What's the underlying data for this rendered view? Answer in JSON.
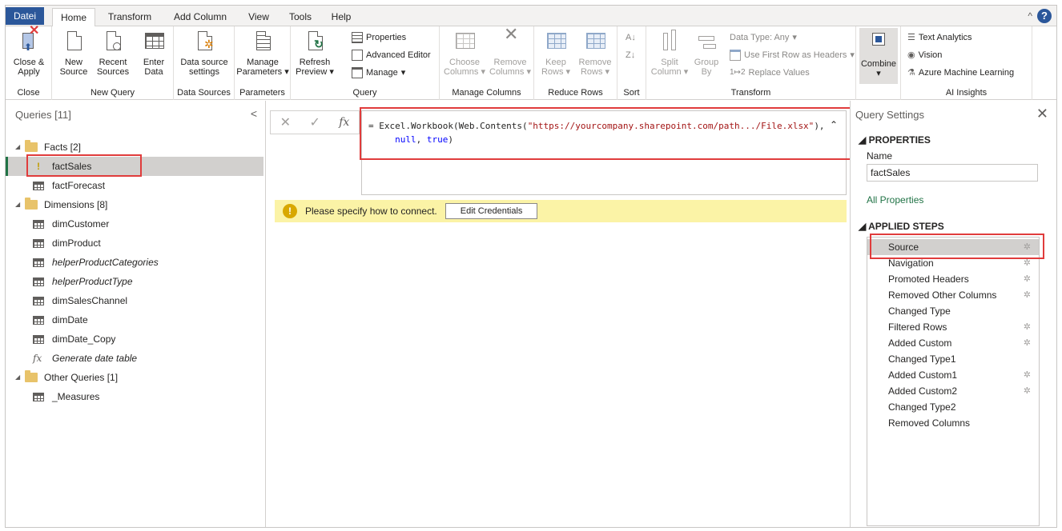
{
  "tabs": [
    "Datei",
    "Home",
    "Transform",
    "Add Column",
    "View",
    "Tools",
    "Help"
  ],
  "ribbon": {
    "close": {
      "close_apply": "Close &",
      "close_apply2": "Apply",
      "group": "Close"
    },
    "new_query": {
      "new": "New",
      "new2": "Source",
      "recent": "Recent",
      "recent2": "Sources",
      "enter": "Enter",
      "enter2": "Data",
      "group": "New Query"
    },
    "data_sources": {
      "settings": "Data source",
      "settings2": "settings",
      "group": "Data Sources"
    },
    "parameters": {
      "manage": "Manage",
      "manage2": "Parameters",
      "group": "Parameters"
    },
    "query": {
      "refresh": "Refresh",
      "refresh2": "Preview",
      "properties": "Properties",
      "advanced": "Advanced Editor",
      "manage": "Manage",
      "group": "Query"
    },
    "manage_columns": {
      "choose": "Choose",
      "choose2": "Columns",
      "remove": "Remove",
      "remove2": "Columns",
      "group": "Manage Columns"
    },
    "reduce_rows": {
      "keep": "Keep",
      "keep2": "Rows",
      "remove": "Remove",
      "remove2": "Rows",
      "group": "Reduce Rows"
    },
    "sort": {
      "group": "Sort"
    },
    "transform": {
      "split": "Split",
      "split2": "Column",
      "group_by": "Group",
      "group_by2": "By",
      "data_type": "Data Type: Any",
      "first_row": "Use First Row as Headers",
      "replace": "Replace Values",
      "group": "Transform"
    },
    "combine": {
      "label": "Combine"
    },
    "ai": {
      "text": "Text Analytics",
      "vision": "Vision",
      "azure": "Azure Machine Learning",
      "group": "AI Insights"
    }
  },
  "queries": {
    "title": "Queries [11]",
    "folders": {
      "facts": "Facts [2]",
      "dimensions": "Dimensions [8]",
      "other": "Other Queries [1]"
    },
    "items": {
      "factSales": "factSales",
      "factForecast": "factForecast",
      "dimCustomer": "dimCustomer",
      "dimProduct": "dimProduct",
      "helperProductCategories": "helperProductCategories",
      "helperProductType": "helperProductType",
      "dimSalesChannel": "dimSalesChannel",
      "dimDate": "dimDate",
      "dimDate_Copy": "dimDate_Copy",
      "generateDate": "Generate date table",
      "measures": "_Measures"
    }
  },
  "formula": {
    "prefix": "= Excel.Workbook(Web.Contents(",
    "url": "\"https://yourcompany.sharepoint.com/path.../File.xlsx\"",
    "suffix": "),",
    "line2_indent": "     ",
    "null": "null",
    "comma": ", ",
    "true": "true",
    "close": ")"
  },
  "warning": {
    "text": "Please specify how to connect.",
    "button": "Edit Credentials"
  },
  "settings": {
    "title": "Query Settings",
    "properties_header": "PROPERTIES",
    "name_label": "Name",
    "name_value": "factSales",
    "all_properties": "All Properties",
    "steps_header": "APPLIED STEPS",
    "steps": [
      "Source",
      "Navigation",
      "Promoted Headers",
      "Removed Other Columns",
      "Changed Type",
      "Filtered Rows",
      "Added Custom",
      "Changed Type1",
      "Added Custom1",
      "Added Custom2",
      "Changed Type2",
      "Removed Columns"
    ]
  },
  "colors": {
    "file_tab": "#2b579a",
    "selection_accent": "#217346",
    "warning_bar": "#fbf3a6",
    "highlight": "#e03c3c"
  }
}
